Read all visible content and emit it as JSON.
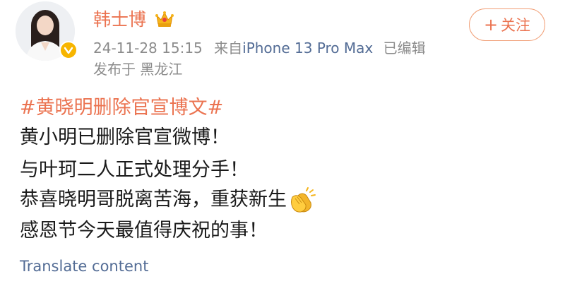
{
  "user": {
    "name": "韩士博",
    "avatar_icon": "user-avatar",
    "verified_icon": "verified-badge-icon",
    "crown_icon": "crown-icon"
  },
  "meta": {
    "timestamp": "24-11-28 15:15",
    "source_prefix": "来自",
    "device": "iPhone 13 Pro Max",
    "edited": "已编辑",
    "location": "发布于 黑龙江"
  },
  "follow": {
    "plus": "+",
    "label": "关注"
  },
  "post": {
    "topic": "#黄晓明删除官宣博文#",
    "lines": [
      "黄小明已删除官宣微博！",
      "与叶珂二人正式处理分手！",
      "恭喜晓明哥脱离苦海，重获新生",
      "感恩节今天最值得庆祝的事！"
    ],
    "emoji_icon": "clapping-hands-icon"
  },
  "translate": {
    "label": "Translate content"
  },
  "colors": {
    "accent": "#eb7350",
    "link": "#536c95",
    "meta": "#8b8b8b",
    "verified": "#f7b500"
  }
}
